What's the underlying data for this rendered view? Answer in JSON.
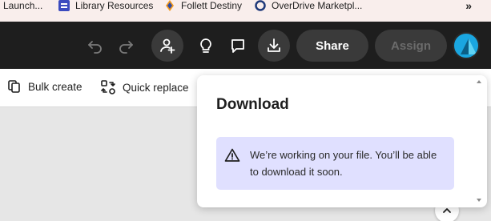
{
  "bookmarks": {
    "items": [
      {
        "label": "Launch...",
        "icon": "launch-icon"
      },
      {
        "label": "Library Resources",
        "icon": "library-icon"
      },
      {
        "label": "Follett Destiny",
        "icon": "follett-icon"
      },
      {
        "label": "OverDrive Marketpl...",
        "icon": "overdrive-icon"
      }
    ],
    "more": "»"
  },
  "toolbar": {
    "share_label": "Share",
    "assign_label": "Assign"
  },
  "subbar": {
    "bulk_create": "Bulk create",
    "quick_replace": "Quick replace"
  },
  "popover": {
    "title": "Download",
    "notice": "We’re working on your file. You’ll be able to download it soon."
  },
  "colors": {
    "toolbar_bg": "#1e1e1e",
    "notice_bg": "#e0e0ff",
    "avatar": "#1aa6e0"
  }
}
